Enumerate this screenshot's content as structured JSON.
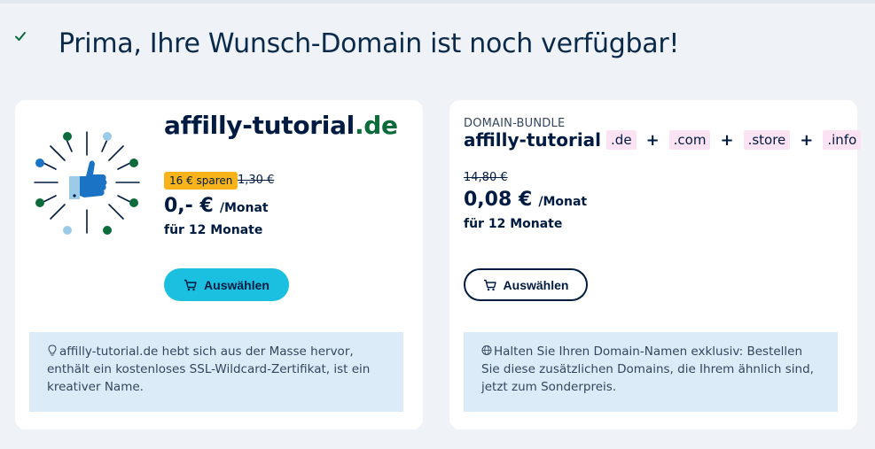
{
  "headline": "Prima, Ihre Wunsch-Domain ist noch verfügbar!",
  "colors": {
    "accent": "#1bc0e0",
    "badge": "#f8b31b",
    "tld_green": "#0b6b3a",
    "navy": "#001b41",
    "chip": "#fbe3f3",
    "info_bg": "#dcebf8"
  },
  "left_card": {
    "domain_name": "affilly-tutorial",
    "domain_tld": ".de",
    "save_badge": "16 € sparen",
    "old_price": "1,30 €",
    "price": "0,- €",
    "price_unit": "/Monat",
    "term": "für 12 Monate",
    "button_label": "Auswählen",
    "info_text": "affilly-tutorial.de hebt sich aus der Masse hervor, enthält ein kostenloses SSL-Wildcard-Zertifikat, ist ein kreativer Name.",
    "icons": {
      "illustration": "thumbs-up-icon",
      "info": "lightbulb-icon",
      "button": "cart-icon"
    }
  },
  "right_card": {
    "bundle_label": "DOMAIN-BUNDLE",
    "bundle_name": "affilly-tutorial",
    "tlds": [
      ".de",
      ".com",
      ".store",
      ".info"
    ],
    "plus": "+",
    "old_price": "14,80 €",
    "price": "0,08 €",
    "price_unit": "/Monat",
    "term": "für 12 Monate",
    "button_label": "Auswählen",
    "info_text": "Halten Sie Ihren Domain-Namen exklusiv: Bestellen Sie diese zusätzlichen Domains, die Ihrem ähnlich sind, jetzt zum Sonderpreis.",
    "icons": {
      "info": "globe-icon",
      "button": "cart-icon"
    }
  }
}
